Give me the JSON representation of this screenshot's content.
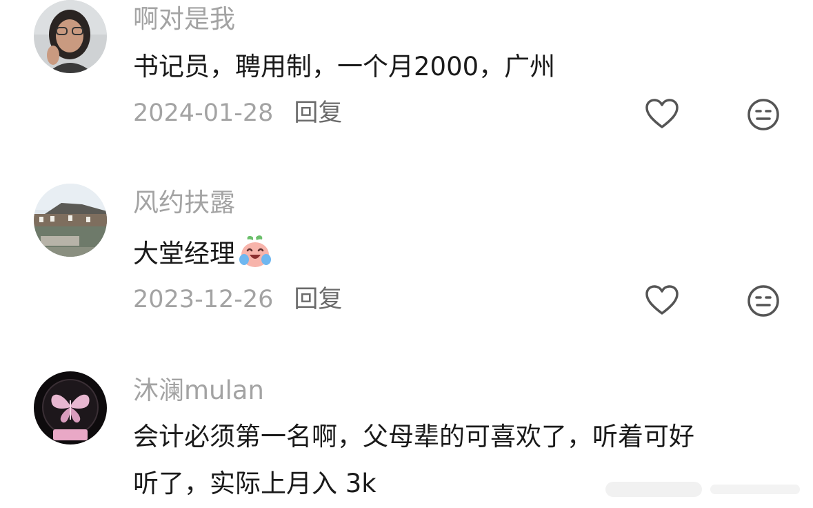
{
  "comments": [
    {
      "username": "啊对是我",
      "content_lines": [
        "书记员，聘用制，一个月2000，广州"
      ],
      "date": "2024-01-28",
      "reply_label": "回复",
      "like_icon": "heart-outline-icon",
      "dislike_icon": "meh-face-icon"
    },
    {
      "username": "风约扶露",
      "content_lines": [
        "大堂经理"
      ],
      "content_emoji": "laugh-cry-peach-emoji",
      "date": "2023-12-26",
      "reply_label": "回复",
      "like_icon": "heart-outline-icon",
      "dislike_icon": "meh-face-icon"
    },
    {
      "username": "沐澜mulan",
      "content_lines": [
        "会计必须第一名啊，父母辈的可喜欢了，听着可好",
        "听了，实际上月入 3k"
      ]
    }
  ],
  "colors": {
    "username": "#a3a3a3",
    "content": "#1a1a1a",
    "meta": "#a3a3a3",
    "reply": "#6b6b6b",
    "icon": "#555555"
  }
}
